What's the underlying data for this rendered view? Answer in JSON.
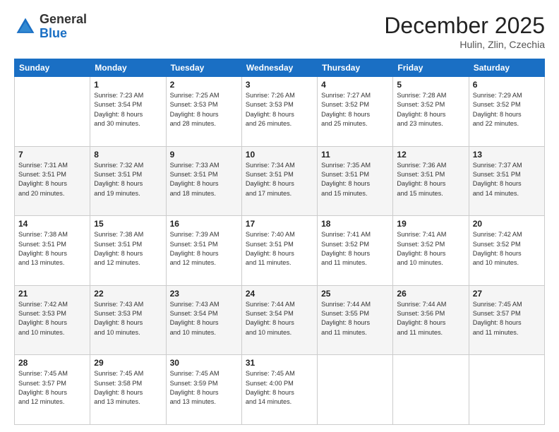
{
  "header": {
    "logo_general": "General",
    "logo_blue": "Blue",
    "month_title": "December 2025",
    "subtitle": "Hulin, Zlin, Czechia"
  },
  "calendar": {
    "days_of_week": [
      "Sunday",
      "Monday",
      "Tuesday",
      "Wednesday",
      "Thursday",
      "Friday",
      "Saturday"
    ],
    "weeks": [
      [
        {
          "day": "",
          "content": ""
        },
        {
          "day": "1",
          "content": "Sunrise: 7:23 AM\nSunset: 3:54 PM\nDaylight: 8 hours\nand 30 minutes."
        },
        {
          "day": "2",
          "content": "Sunrise: 7:25 AM\nSunset: 3:53 PM\nDaylight: 8 hours\nand 28 minutes."
        },
        {
          "day": "3",
          "content": "Sunrise: 7:26 AM\nSunset: 3:53 PM\nDaylight: 8 hours\nand 26 minutes."
        },
        {
          "day": "4",
          "content": "Sunrise: 7:27 AM\nSunset: 3:52 PM\nDaylight: 8 hours\nand 25 minutes."
        },
        {
          "day": "5",
          "content": "Sunrise: 7:28 AM\nSunset: 3:52 PM\nDaylight: 8 hours\nand 23 minutes."
        },
        {
          "day": "6",
          "content": "Sunrise: 7:29 AM\nSunset: 3:52 PM\nDaylight: 8 hours\nand 22 minutes."
        }
      ],
      [
        {
          "day": "7",
          "content": "Sunrise: 7:31 AM\nSunset: 3:51 PM\nDaylight: 8 hours\nand 20 minutes."
        },
        {
          "day": "8",
          "content": "Sunrise: 7:32 AM\nSunset: 3:51 PM\nDaylight: 8 hours\nand 19 minutes."
        },
        {
          "day": "9",
          "content": "Sunrise: 7:33 AM\nSunset: 3:51 PM\nDaylight: 8 hours\nand 18 minutes."
        },
        {
          "day": "10",
          "content": "Sunrise: 7:34 AM\nSunset: 3:51 PM\nDaylight: 8 hours\nand 17 minutes."
        },
        {
          "day": "11",
          "content": "Sunrise: 7:35 AM\nSunset: 3:51 PM\nDaylight: 8 hours\nand 15 minutes."
        },
        {
          "day": "12",
          "content": "Sunrise: 7:36 AM\nSunset: 3:51 PM\nDaylight: 8 hours\nand 15 minutes."
        },
        {
          "day": "13",
          "content": "Sunrise: 7:37 AM\nSunset: 3:51 PM\nDaylight: 8 hours\nand 14 minutes."
        }
      ],
      [
        {
          "day": "14",
          "content": "Sunrise: 7:38 AM\nSunset: 3:51 PM\nDaylight: 8 hours\nand 13 minutes."
        },
        {
          "day": "15",
          "content": "Sunrise: 7:38 AM\nSunset: 3:51 PM\nDaylight: 8 hours\nand 12 minutes."
        },
        {
          "day": "16",
          "content": "Sunrise: 7:39 AM\nSunset: 3:51 PM\nDaylight: 8 hours\nand 12 minutes."
        },
        {
          "day": "17",
          "content": "Sunrise: 7:40 AM\nSunset: 3:51 PM\nDaylight: 8 hours\nand 11 minutes."
        },
        {
          "day": "18",
          "content": "Sunrise: 7:41 AM\nSunset: 3:52 PM\nDaylight: 8 hours\nand 11 minutes."
        },
        {
          "day": "19",
          "content": "Sunrise: 7:41 AM\nSunset: 3:52 PM\nDaylight: 8 hours\nand 10 minutes."
        },
        {
          "day": "20",
          "content": "Sunrise: 7:42 AM\nSunset: 3:52 PM\nDaylight: 8 hours\nand 10 minutes."
        }
      ],
      [
        {
          "day": "21",
          "content": "Sunrise: 7:42 AM\nSunset: 3:53 PM\nDaylight: 8 hours\nand 10 minutes."
        },
        {
          "day": "22",
          "content": "Sunrise: 7:43 AM\nSunset: 3:53 PM\nDaylight: 8 hours\nand 10 minutes."
        },
        {
          "day": "23",
          "content": "Sunrise: 7:43 AM\nSunset: 3:54 PM\nDaylight: 8 hours\nand 10 minutes."
        },
        {
          "day": "24",
          "content": "Sunrise: 7:44 AM\nSunset: 3:54 PM\nDaylight: 8 hours\nand 10 minutes."
        },
        {
          "day": "25",
          "content": "Sunrise: 7:44 AM\nSunset: 3:55 PM\nDaylight: 8 hours\nand 11 minutes."
        },
        {
          "day": "26",
          "content": "Sunrise: 7:44 AM\nSunset: 3:56 PM\nDaylight: 8 hours\nand 11 minutes."
        },
        {
          "day": "27",
          "content": "Sunrise: 7:45 AM\nSunset: 3:57 PM\nDaylight: 8 hours\nand 11 minutes."
        }
      ],
      [
        {
          "day": "28",
          "content": "Sunrise: 7:45 AM\nSunset: 3:57 PM\nDaylight: 8 hours\nand 12 minutes."
        },
        {
          "day": "29",
          "content": "Sunrise: 7:45 AM\nSunset: 3:58 PM\nDaylight: 8 hours\nand 13 minutes."
        },
        {
          "day": "30",
          "content": "Sunrise: 7:45 AM\nSunset: 3:59 PM\nDaylight: 8 hours\nand 13 minutes."
        },
        {
          "day": "31",
          "content": "Sunrise: 7:45 AM\nSunset: 4:00 PM\nDaylight: 8 hours\nand 14 minutes."
        },
        {
          "day": "",
          "content": ""
        },
        {
          "day": "",
          "content": ""
        },
        {
          "day": "",
          "content": ""
        }
      ]
    ]
  }
}
